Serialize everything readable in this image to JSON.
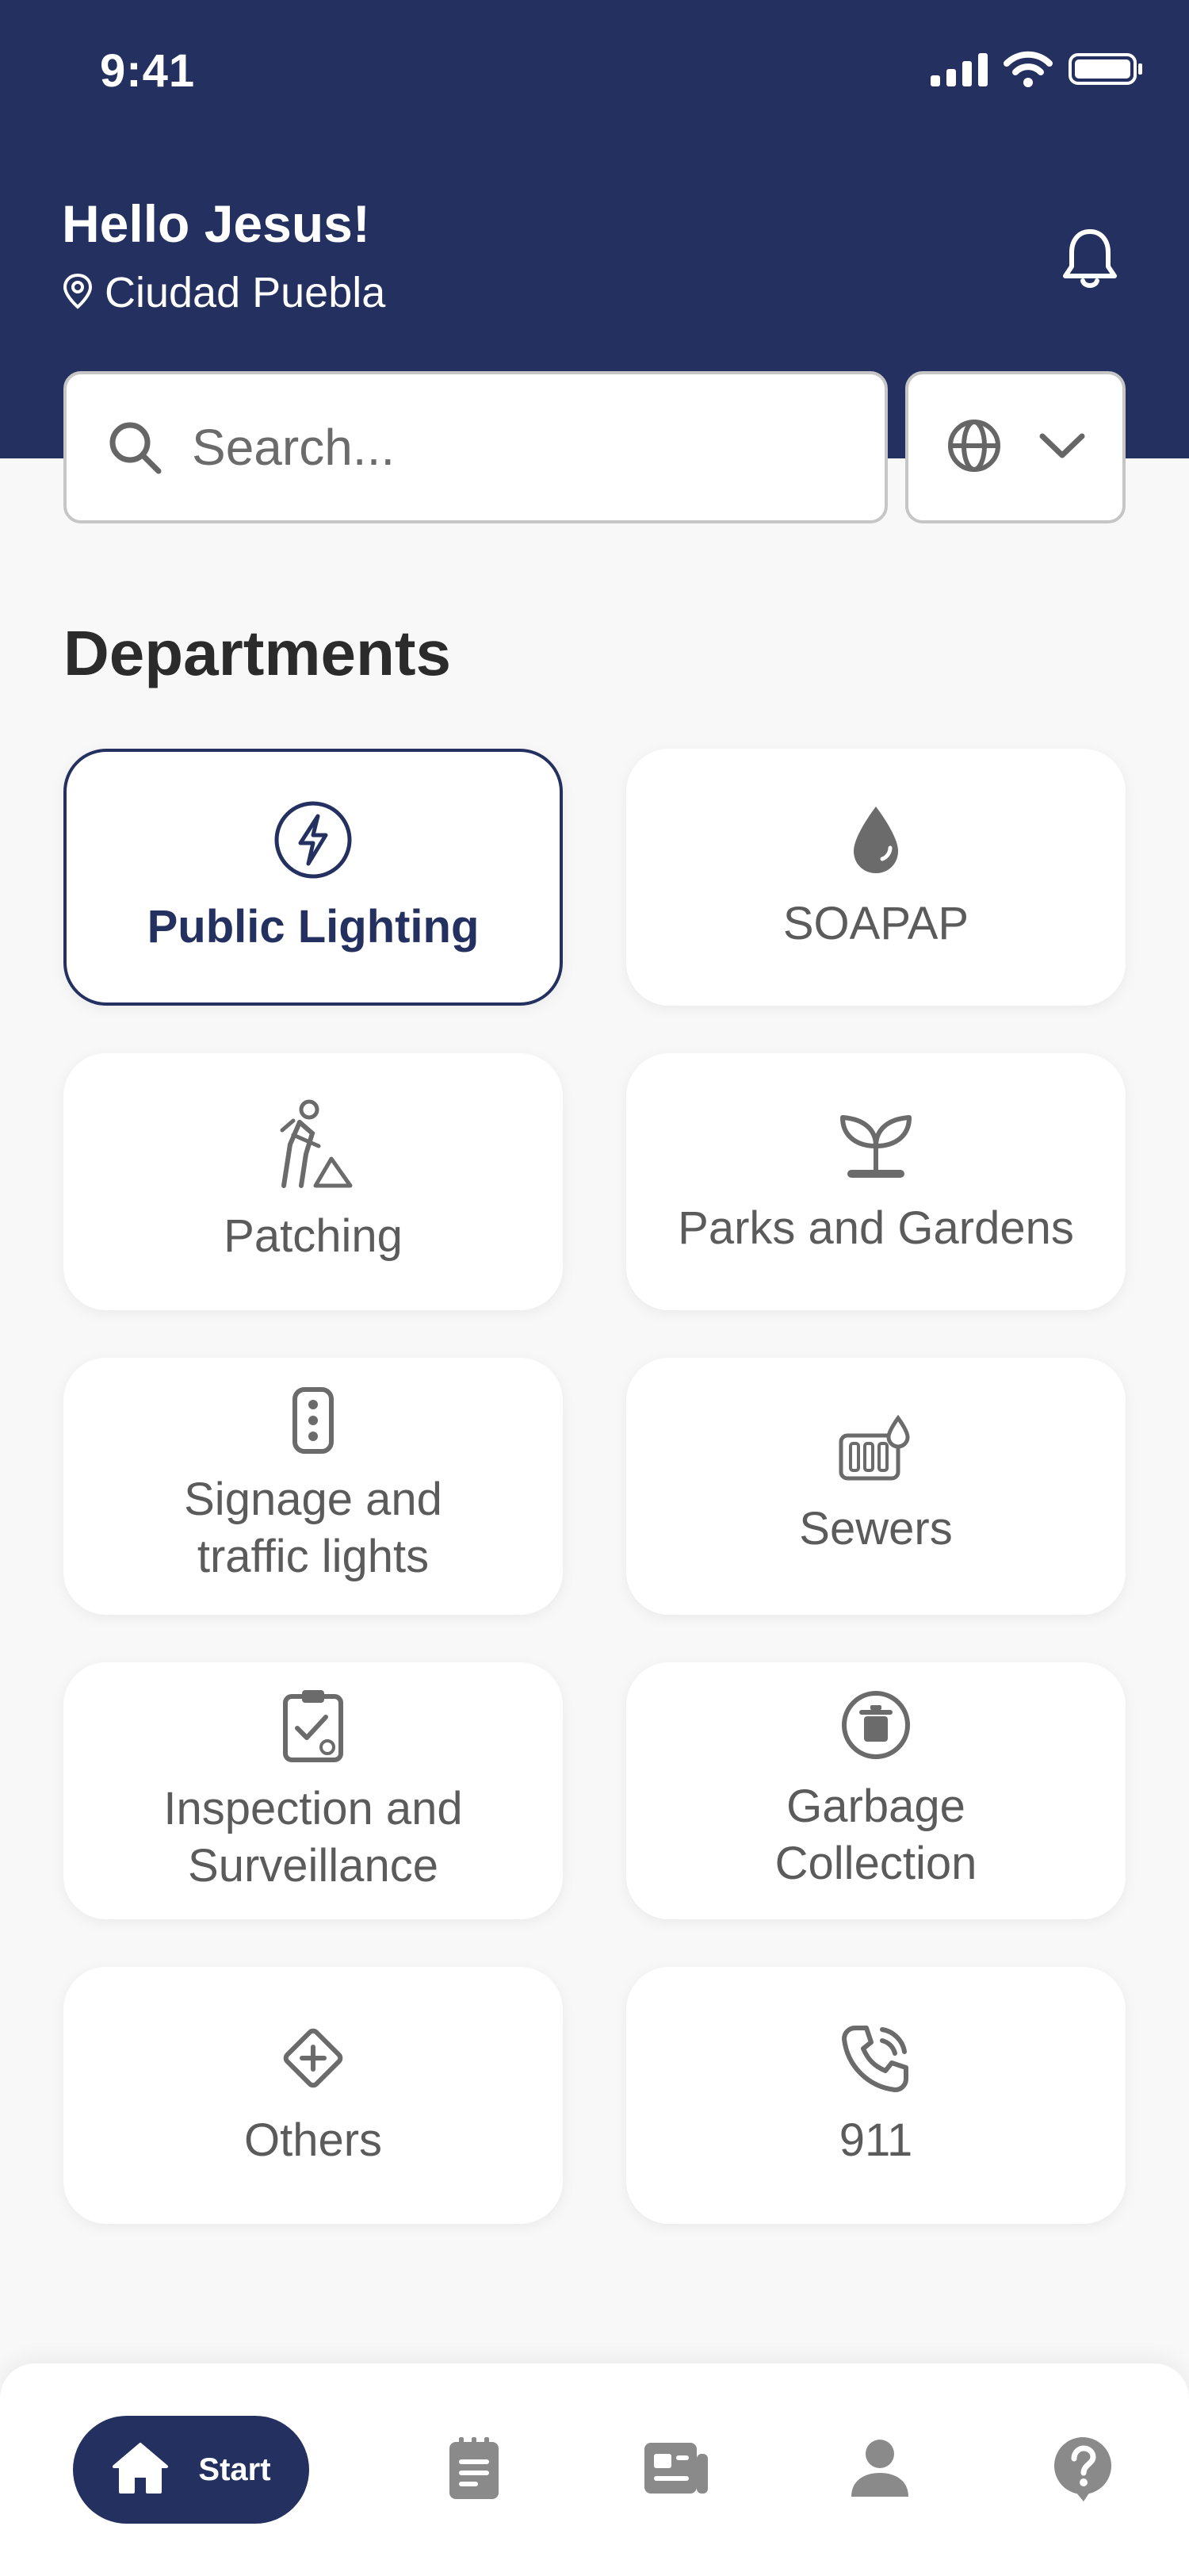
{
  "status_bar": {
    "time": "9:41"
  },
  "header": {
    "greeting": "Hello Jesus!",
    "location": "Ciudad Puebla"
  },
  "search": {
    "placeholder": "Search..."
  },
  "section": {
    "title": "Departments"
  },
  "departments": [
    {
      "label": "Public Lighting",
      "icon": "lightning-icon",
      "selected": true
    },
    {
      "label": "SOAPAP",
      "icon": "water-drop-icon"
    },
    {
      "label": "Patching",
      "icon": "road-worker-icon"
    },
    {
      "label": "Parks and Gardens",
      "icon": "plant-icon"
    },
    {
      "label": "Signage and traffic lights",
      "icon": "traffic-light-icon"
    },
    {
      "label": "Sewers",
      "icon": "sewer-icon"
    },
    {
      "label": "Inspection and Surveillance",
      "icon": "clipboard-check-icon"
    },
    {
      "label": "Garbage Collection",
      "icon": "trash-icon"
    },
    {
      "label": "Others",
      "icon": "diamond-plus-icon"
    },
    {
      "label": "911",
      "icon": "phone-call-icon"
    }
  ],
  "bottom_nav": {
    "start_label": "Start",
    "items": [
      "home-icon",
      "notepad-icon",
      "newspaper-icon",
      "user-icon",
      "help-icon"
    ]
  },
  "colors": {
    "primary": "#243160",
    "background": "#f8f8f8",
    "icon_gray": "#6b6b6b"
  }
}
